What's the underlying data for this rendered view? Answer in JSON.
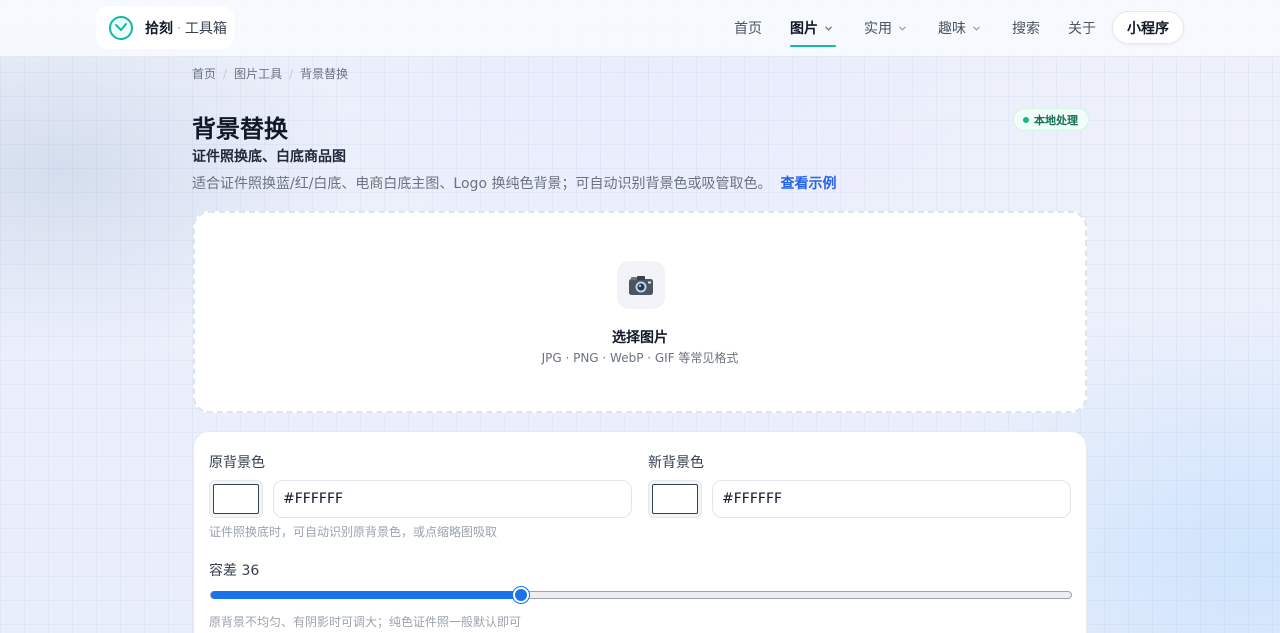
{
  "brand": {
    "name": "拾刻",
    "dot": "·",
    "sub": "工具箱"
  },
  "nav": {
    "items": [
      {
        "label": "首页"
      },
      {
        "label": "图片"
      },
      {
        "label": "实用"
      },
      {
        "label": "趣味"
      },
      {
        "label": "搜索"
      },
      {
        "label": "关于"
      }
    ],
    "mini_program": "小程序"
  },
  "breadcrumb": [
    "首页",
    "图片工具",
    "背景替换"
  ],
  "breadcrumb_sep": "/",
  "page": {
    "title": "背景替换",
    "badge": "本地处理",
    "subtitle": "证件照换底、白底商品图",
    "description": "适合证件照换蓝/红/白底、电商白底主图、Logo 换纯色背景；可自动识别背景色或吸管取色。",
    "example_link": "查看示例"
  },
  "upload": {
    "icon": "camera-icon",
    "title": "选择图片",
    "hint": "JPG · PNG · WebP · GIF 等常见格式"
  },
  "settings": {
    "original_bg": {
      "label": "原背景色",
      "value": "#FFFFFF",
      "color": "#FFFFFF"
    },
    "new_bg": {
      "label": "新背景色",
      "value": "#FFFFFF",
      "color": "#FFFFFF"
    },
    "original_hint": "证件照换底时，可自动识别原背景色，或点缩略图吸取",
    "tolerance": {
      "label": "容差 36",
      "value": 36,
      "min": 0,
      "max": 100
    },
    "tolerance_hint": "原背景不均匀、有阴影时可调大；纯色证件照一般默认即可"
  },
  "colors": {
    "accent": "#14b8a6",
    "link": "#2563eb",
    "slider": "#1a73e8",
    "badge_dot": "#10b981"
  }
}
